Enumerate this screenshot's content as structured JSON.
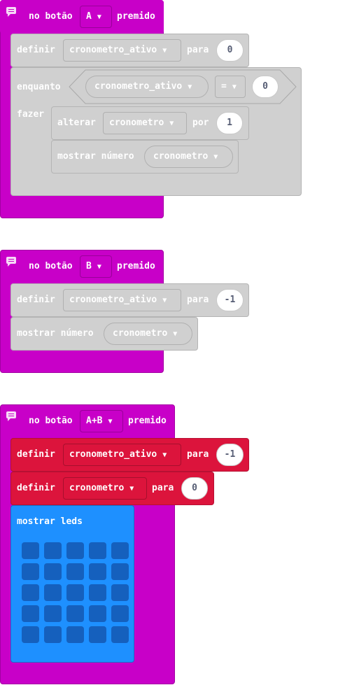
{
  "colors": {
    "event": "#c800c8",
    "variables_grey": "#d0d0d0",
    "variables_red": "#dc143c",
    "basic_blue": "#1e90ff",
    "led_off": "#1560bd",
    "number_text": "#575e75"
  },
  "block_a": {
    "event_prefix": "no botão",
    "button_value": "A",
    "event_suffix": "premido",
    "set_label": "definir",
    "set_var": "cronometro_ativo",
    "set_to": "para",
    "set_value": "0",
    "while_label": "enquanto",
    "cond_var": "cronometro_ativo",
    "cond_op": "=",
    "cond_value": "0",
    "do_label": "fazer",
    "change_label": "alterar",
    "change_var": "cronometro",
    "change_by": "por",
    "change_value": "1",
    "show_label": "mostrar número",
    "show_var": "cronometro"
  },
  "block_b": {
    "event_prefix": "no botão",
    "button_value": "B",
    "event_suffix": "premido",
    "set_label": "definir",
    "set_var": "cronometro_ativo",
    "set_to": "para",
    "set_value": "-1",
    "show_label": "mostrar número",
    "show_var": "cronometro"
  },
  "block_ab": {
    "event_prefix": "no botão",
    "button_value": "A+B",
    "event_suffix": "premido",
    "set1_label": "definir",
    "set1_var": "cronometro_ativo",
    "set1_to": "para",
    "set1_value": "-1",
    "set2_label": "definir",
    "set2_var": "cronometro",
    "set2_to": "para",
    "set2_value": "0",
    "leds_label": "mostrar leds",
    "leds_state": [
      [
        0,
        0,
        0,
        0,
        0
      ],
      [
        0,
        0,
        0,
        0,
        0
      ],
      [
        0,
        0,
        0,
        0,
        0
      ],
      [
        0,
        0,
        0,
        0,
        0
      ],
      [
        0,
        0,
        0,
        0,
        0
      ]
    ]
  }
}
